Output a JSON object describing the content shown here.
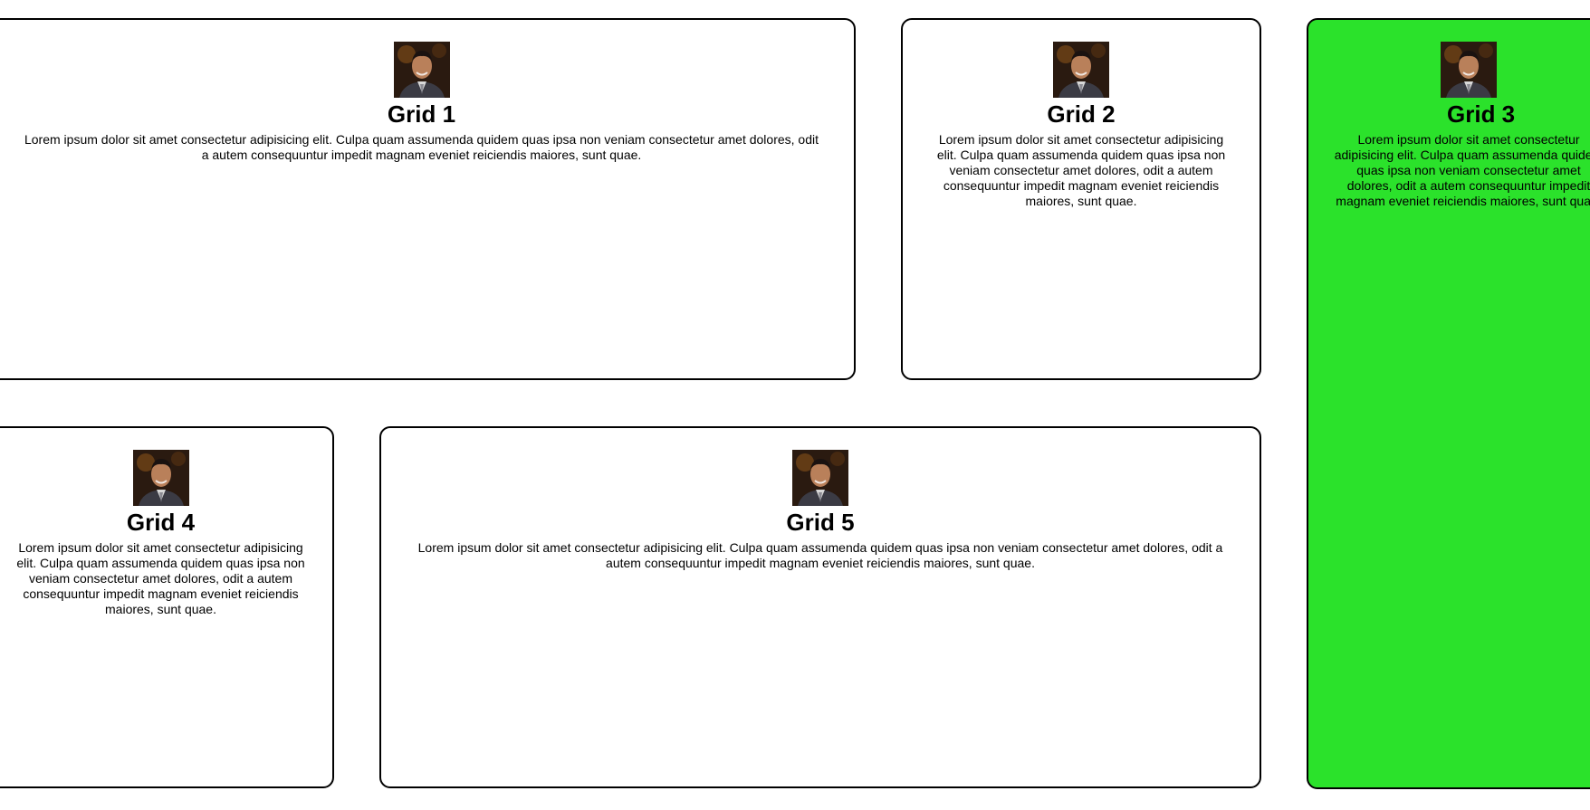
{
  "cards": [
    {
      "title": "Grid 1",
      "text": "Lorem ipsum dolor sit amet consectetur adipisicing elit. Culpa quam assumenda quidem quas ipsa non veniam consectetur amet dolores, odit a autem consequuntur impedit magnam eveniet reiciendis maiores, sunt quae.",
      "background": "#ffffff"
    },
    {
      "title": "Grid 2",
      "text": "Lorem ipsum dolor sit amet consectetur adipisicing elit. Culpa quam assumenda quidem quas ipsa non veniam consectetur amet dolores, odit a autem consequuntur impedit magnam eveniet reiciendis maiores, sunt quae.",
      "background": "#ffffff"
    },
    {
      "title": "Grid 3",
      "text": "Lorem ipsum dolor sit amet consectetur adipisicing elit. Culpa quam assumenda quidem quas ipsa non veniam consectetur amet dolores, odit a autem consequuntur impedit magnam eveniet reiciendis maiores, sunt quae.",
      "background": "#2be22b"
    },
    {
      "title": "Grid 4",
      "text": "Lorem ipsum dolor sit amet consectetur adipisicing elit. Culpa quam assumenda quidem quas ipsa non veniam consectetur amet dolores, odit a autem consequuntur impedit magnam eveniet reiciendis maiores, sunt quae.",
      "background": "#ffffff"
    },
    {
      "title": "Grid 5",
      "text": "Lorem ipsum dolor sit amet consectetur adipisicing elit. Culpa quam assumenda quidem quas ipsa non veniam consectetur amet dolores, odit a autem consequuntur impedit magnam eveniet reiciendis maiores, sunt quae.",
      "background": "#ffffff"
    }
  ],
  "avatar_icon": "profile-photo"
}
